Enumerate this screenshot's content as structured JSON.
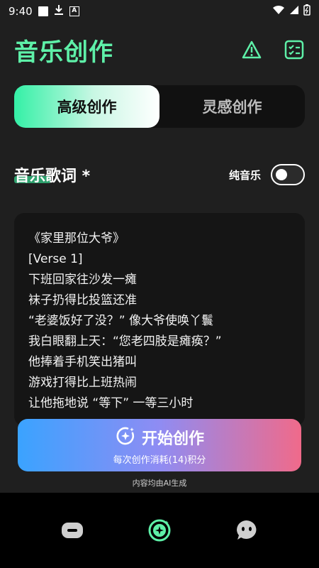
{
  "status_bar": {
    "time": "9:40"
  },
  "header": {
    "title": "音乐创作"
  },
  "tabs": [
    {
      "label": "高级创作",
      "active": true
    },
    {
      "label": "灵感创作",
      "active": false
    }
  ],
  "lyrics": {
    "title": "音乐歌词 *",
    "toggle_label": "纯音乐",
    "toggle_on": false,
    "lines": [
      "《家里那位大爷》",
      "[Verse 1]",
      "下班回家往沙发一瘫",
      "袜子扔得比投篮还准",
      "“老婆饭好了没？” 像大爷使唤丫鬟",
      "我白眼翻上天：“您老四肢是瘫痪？”",
      "他捧着手机笑出猪叫",
      "游戏打得比上班热闹",
      "让他拖地说 “等下” 一等三小时"
    ]
  },
  "start_button": {
    "label": "开始创作",
    "sub": "每次创作消耗(14)积分"
  },
  "ai_note": "内容均由AI生成",
  "colors": {
    "accent": "#5ef0a8",
    "background": "#1f1f1f"
  },
  "icons": {
    "header": [
      "warning-icon",
      "checklist-icon"
    ],
    "nav": [
      "chat-bubble-icon",
      "create-sparkle-icon",
      "face-bubble-icon"
    ]
  }
}
